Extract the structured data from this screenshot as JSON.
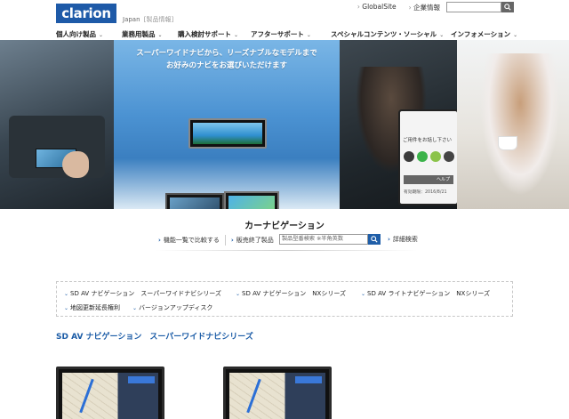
{
  "header": {
    "logo": "clarion",
    "region": "Japan",
    "region_link": "[製品情報]",
    "links": [
      "GlobalSite",
      "企業情報"
    ]
  },
  "nav": {
    "items": [
      "個人向け製品",
      "業務用製品",
      "購入検討サポート",
      "アフターサポート",
      "スペシャルコンテンツ・ソーシャル",
      "インフォメーション"
    ]
  },
  "hero": {
    "line1": "スーパーワイドナビから、リーズナブルなモデルまで",
    "line2": "お好みのナビをお選びいただけます",
    "phone_prompt": "ご用件をお話し下さい",
    "phone_help": "ヘルプ",
    "phone_date": "有効期限：2016/8/21"
  },
  "section": {
    "title": "カーナビゲーション",
    "compare_link": "機能一覧で比較する",
    "discontinued_link": "販売終了製品",
    "model_search_placeholder": "製品型番検索 ※半角英数",
    "advanced_link": "詳細検索"
  },
  "categories": [
    "SD AV ナビゲーション　スーパーワイドナビシリーズ",
    "SD AV ナビゲーション　NXシリーズ",
    "SD AV ライトナビゲーション　NXシリーズ",
    "地図更新延長権利",
    "バージョンアップディスク"
  ],
  "series_title": "SD AV ナビゲーション　スーパーワイドナビシリーズ",
  "colors": {
    "brand": "#1e5aa8",
    "link_blue": "#1a5ba6"
  }
}
